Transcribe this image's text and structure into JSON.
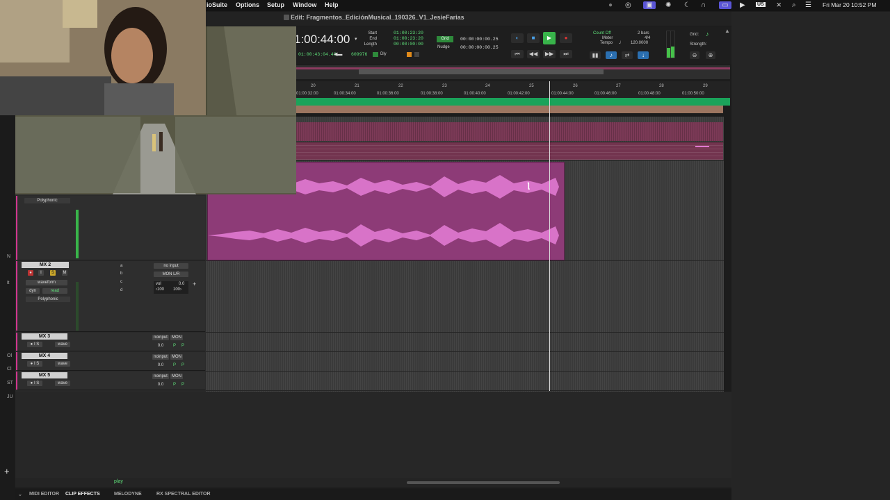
{
  "menubar": {
    "app_partial": "ioSuite",
    "items": [
      "Options",
      "Setup",
      "Window",
      "Help"
    ],
    "keyboard": "US",
    "datetime": "Fri Mar 20  10:52 PM"
  },
  "window": {
    "title": "Edit: Fragmentos_EdiciónMusical_190326_V1_JesieFarias"
  },
  "transport": {
    "main_counter": "1:00:44:00",
    "sub_counter": "01:00:43:04.48",
    "sub_samples": "609976",
    "start_label": "Start",
    "end_label": "End",
    "length_label": "Length",
    "start": "01:00:23:20",
    "end": "01:00:23:20",
    "length": "00:00:00:00",
    "grid_label": "Grid",
    "nudge_label": "Nudge",
    "grid_value": "00:00:00:00.25",
    "nudge_value": "00:00:00:00.25",
    "count_off": "Count Off",
    "meter_label": "Meter",
    "tempo_label": "Tempo",
    "count_bars": "2 bars",
    "meter": "4/4",
    "tempo": "120.0000",
    "grid_right_label": "Grid:",
    "strength_label": "Strength:",
    "dly": "Dly"
  },
  "ruler": {
    "bars": [
      "20",
      "21",
      "22",
      "23",
      "24",
      "25",
      "26",
      "27",
      "28",
      "29"
    ],
    "times": [
      "01:00:32:00",
      "01:00:34:00",
      "01:00:36:00",
      "01:00:38:00",
      "01:00:40:00",
      "01:00:42:00",
      "01:00:44:00",
      "01:00:46:00",
      "01:00:48:00",
      "01:00:50:00"
    ]
  },
  "tracks": {
    "mx1": {
      "plugin": "Polyphonic"
    },
    "mx2": {
      "name": "MX 2",
      "input": "no input",
      "output": "MON L/R",
      "view": "waveform",
      "dyn": "dyn",
      "read": "read",
      "plugin": "Polyphonic",
      "vol_label": "vol",
      "vol_value": "0.0",
      "pan_l": "‹100",
      "pan_r": "100›",
      "sends": [
        "a",
        "b",
        "c",
        "d"
      ]
    },
    "small": [
      {
        "name": "MX 3",
        "input": "noinput",
        "mon": "MON",
        "view": "wave",
        "mode": "read",
        "vol": "0.0",
        "p1": "P",
        "p2": "P"
      },
      {
        "name": "MX 4",
        "input": "noinput",
        "mon": "MON",
        "view": "wave",
        "mode": "read",
        "vol": "0.0",
        "p1": "P",
        "p2": "P"
      },
      {
        "name": "MX 5",
        "input": "noinput",
        "mon": "MON",
        "view": "wave",
        "mode": "read",
        "vol": "0.0",
        "p1": "P",
        "p2": "P"
      }
    ]
  },
  "left_edge_letters": [
    "N",
    "it",
    "Ol",
    "Cl",
    "ST",
    "JU"
  ],
  "bottom": {
    "tabs": [
      "MIDI EDITOR",
      "CLIP EFFECTS",
      "MELODYNE",
      "RX SPECTRAL EDITOR"
    ],
    "status": "play"
  },
  "colors": {
    "clip_pink": "#8d3b77",
    "waveform": "#e07ad0",
    "marker_green": "#1aa35a",
    "tempo_brown": "#9c7560",
    "counter_green": "#5fe07a"
  }
}
